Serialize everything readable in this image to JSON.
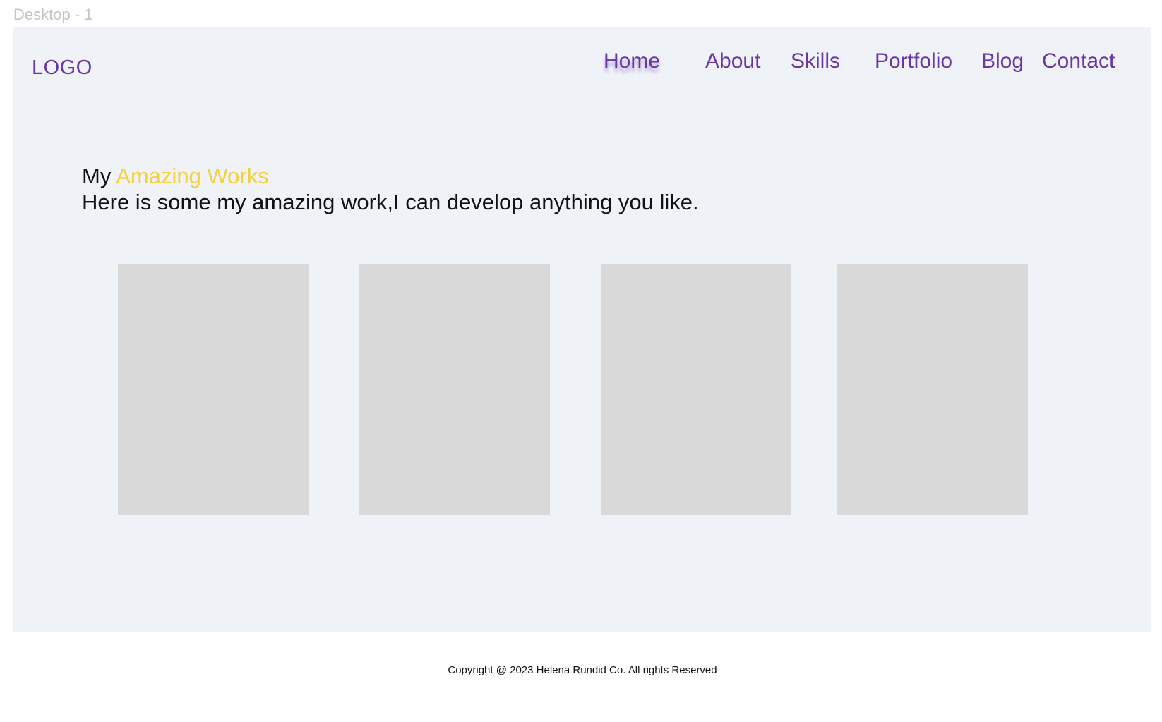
{
  "frame": {
    "label": "Desktop - 1"
  },
  "header": {
    "logo": "LOGO",
    "nav": [
      {
        "label": "Home",
        "active": true
      },
      {
        "label": "About",
        "active": false
      },
      {
        "label": "Skills",
        "active": false
      },
      {
        "label": "Portfolio",
        "active": false
      },
      {
        "label": "Blog",
        "active": false
      },
      {
        "label": "Contact",
        "active": false
      }
    ]
  },
  "portfolio": {
    "title_prefix": "My ",
    "title_accent": "Amazing Works",
    "subtitle": "Here is some my amazing work,I can develop anything you like.",
    "cards": [
      {
        "label": ""
      },
      {
        "label": ""
      },
      {
        "label": ""
      },
      {
        "label": ""
      }
    ]
  },
  "footer": {
    "copyright": "Copyright @ 2023 Helena Rundid Co. All rights Reserved"
  },
  "colors": {
    "accent_purple": "#6a35a8",
    "accent_yellow": "#f4d03f",
    "frame_background": "#eff3f8",
    "card_placeholder": "#d9d9d9"
  }
}
